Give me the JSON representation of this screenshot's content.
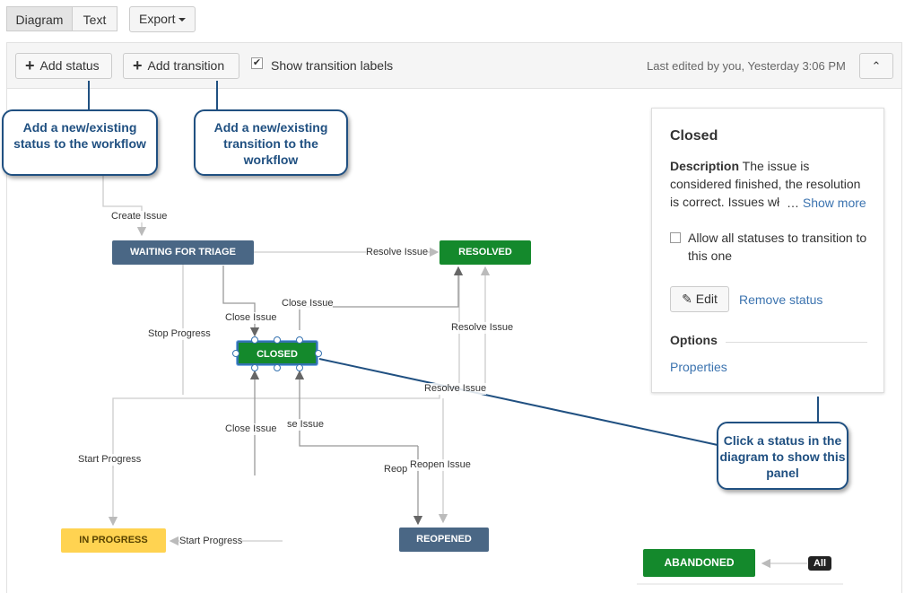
{
  "tabs": [
    {
      "label": "Diagram",
      "active": true
    },
    {
      "label": "Text",
      "active": false
    }
  ],
  "export": {
    "label": "Export"
  },
  "toolbar": {
    "add_status": "Add status",
    "add_transition": "Add transition",
    "show_labels": "Show transition labels",
    "show_labels_checked": true,
    "last_edited": "Last edited by you, Yesterday 3:06 PM"
  },
  "statuses": {
    "waiting": "WAITING FOR TRIAGE",
    "resolved": "RESOLVED",
    "closed": "CLOSED",
    "in_progress": "IN PROGRESS",
    "reopened": "REOPENED",
    "abandoned": "ABANDONED"
  },
  "transitions": {
    "create_issue": "Create Issue",
    "resolve_issue_top": "Resolve Issue",
    "close_issue_top": "Close Issue",
    "close_issue_left": "Close Issue",
    "stop_progress": "Stop Progress",
    "resolve_issue_right": "Resolve Issue",
    "resolve_issue_mid": "Resolve Issue",
    "close_issue_bottom": "Close Issue",
    "se_issue": "se Issue",
    "start_progress_left": "Start Progress",
    "reop": "Reop",
    "reopen_issue": "Reopen Issue",
    "start_progress_bottom": "Start Progress"
  },
  "all_badge": "All",
  "callouts": {
    "add_status": "Add a new/existing status to the workflow",
    "add_transition": "Add a new/existing transition to the workflow",
    "click_status": "Click a status in the diagram to show this panel"
  },
  "panel": {
    "title": "Closed",
    "description_label": "Description",
    "description_text": "The issue is considered finished, the resolution is correct. Issues wł",
    "ellipsis": "…",
    "show_more": "Show more",
    "allow_all": "Allow all statuses to transition to this one",
    "allow_all_checked": false,
    "edit": "Edit",
    "remove_status": "Remove status",
    "options_label": "Options",
    "properties": "Properties"
  },
  "colors": {
    "status_blue": "#4a6785",
    "status_green": "#14892c",
    "status_yellow": "#ffd351",
    "callout_border": "#205081",
    "link": "#3b73af"
  }
}
